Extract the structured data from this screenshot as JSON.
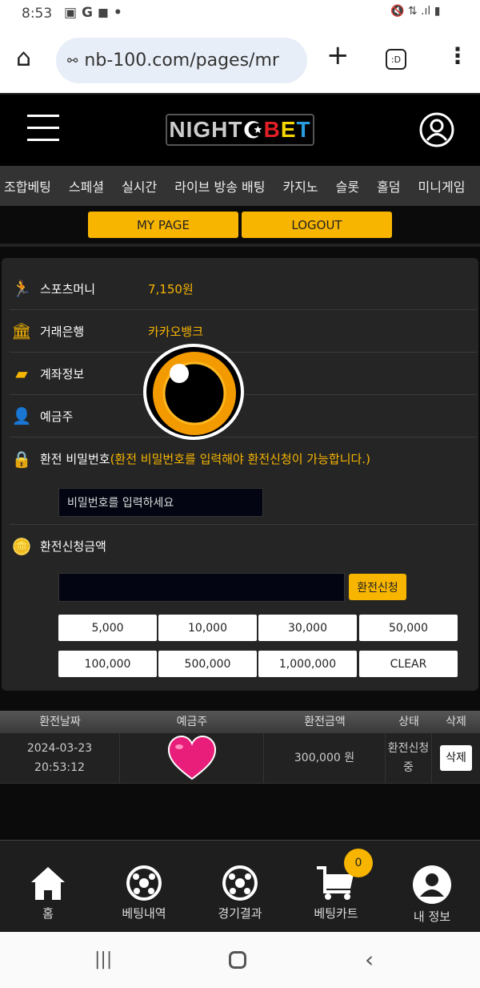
{
  "status_bar": {
    "time": "8:53",
    "icons": [
      "image-icon",
      "google-icon",
      "b-app-icon",
      "dot-icon",
      "mute-icon",
      "lte-icon",
      "signal-icon",
      "battery-icon"
    ]
  },
  "browser": {
    "url": "nb-100.com/pages/mr",
    "tab_count": ":D"
  },
  "header": {
    "logo": "NIGHTBET"
  },
  "nav": {
    "items": [
      "조합베팅",
      "스페셜",
      "실시간",
      "라이브 방송 배팅",
      "카지노",
      "슬롯",
      "홀덤",
      "미니게임"
    ]
  },
  "top_buttons": {
    "my_page": "MY PAGE",
    "logout": "LOGOUT"
  },
  "info": {
    "sports_money_label": "스포츠머니",
    "sports_money_value": "7,150원",
    "bank_label": "거래은행",
    "bank_value": "카카오뱅크",
    "account_label": "계좌정보",
    "holder_label": "예금주",
    "password_label": "환전 비밀번호",
    "password_note": "(환전 비밀번호를 입력해야 환전신청이 가능합니다.)",
    "password_placeholder": "비밀번호를 입력하세요",
    "amount_label": "환전신청금액",
    "amount_value": "",
    "submit_label": "환전신청",
    "amounts": [
      "5,000",
      "10,000",
      "30,000",
      "50,000",
      "100,000",
      "500,000",
      "1,000,000"
    ],
    "clear_label": "CLEAR"
  },
  "table": {
    "headers": [
      "환전날짜",
      "예금주",
      "환전금액",
      "상태",
      "삭제"
    ],
    "rows": [
      {
        "date": "2024-03-23",
        "time": "20:53:12",
        "amount": "300,000 원",
        "status": "환전신청 중",
        "delete": "삭제"
      }
    ]
  },
  "bottom_nav": {
    "items": [
      "홈",
      "베팅내역",
      "경기결과",
      "베팅카트",
      "내 정보"
    ],
    "cart_badge": "0"
  },
  "colors": {
    "accent": "#f7b500",
    "panel": "#252525",
    "heart": "#e91e7a"
  }
}
